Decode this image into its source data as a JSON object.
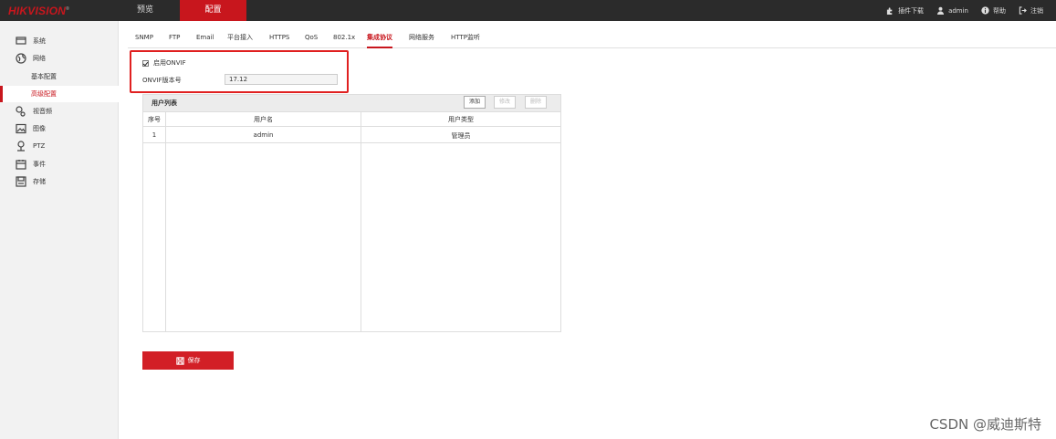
{
  "brand": {
    "name": "HIKVISION",
    "mark": "®"
  },
  "top_nav": {
    "preview": "预览",
    "config": "配置"
  },
  "top_right": {
    "plugin": "插件下载",
    "user": "admin",
    "help": "帮助",
    "logout": "注销"
  },
  "sidebar": {
    "system": "系统",
    "network": "网络",
    "basic": "基本配置",
    "advanced": "高级配置",
    "video_audio": "视音频",
    "image": "图像",
    "ptz": "PTZ",
    "event": "事件",
    "storage": "存储"
  },
  "subtabs": [
    "SNMP",
    "FTP",
    "Email",
    "平台接入",
    "HTTPS",
    "QoS",
    "802.1x",
    "集成协议",
    "网络服务",
    "HTTP监听"
  ],
  "onvif": {
    "enable_label": "启用ONVIF",
    "enabled": true,
    "version_label": "ONVIF版本号",
    "version_value": "17.12"
  },
  "user_list": {
    "title": "用户列表",
    "add": "添加",
    "modify": "修改",
    "delete": "删除",
    "columns": [
      "序号",
      "用户名",
      "用户类型"
    ],
    "rows": [
      {
        "index": "1",
        "name": "admin",
        "type": "管理员"
      }
    ]
  },
  "save": "保存",
  "watermark": "CSDN @威迪斯特",
  "colors": {
    "accent": "#c8161d",
    "topbar": "#2b2b2b",
    "highlight": "#e02020"
  }
}
